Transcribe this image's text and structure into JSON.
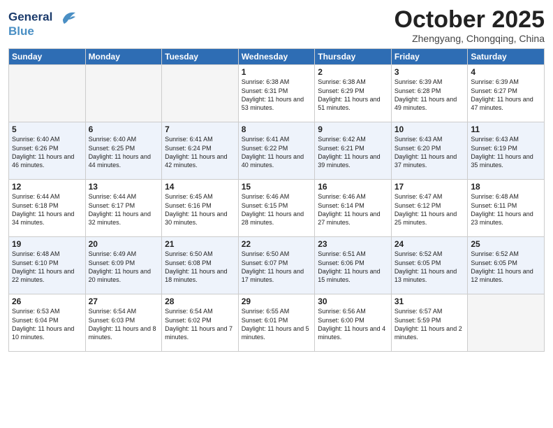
{
  "header": {
    "logo_line1": "General",
    "logo_line2": "Blue",
    "month": "October 2025",
    "location": "Zhengyang, Chongqing, China"
  },
  "weekdays": [
    "Sunday",
    "Monday",
    "Tuesday",
    "Wednesday",
    "Thursday",
    "Friday",
    "Saturday"
  ],
  "weeks": [
    [
      {
        "day": "",
        "info": ""
      },
      {
        "day": "",
        "info": ""
      },
      {
        "day": "",
        "info": ""
      },
      {
        "day": "1",
        "info": "Sunrise: 6:38 AM\nSunset: 6:31 PM\nDaylight: 11 hours and 53 minutes."
      },
      {
        "day": "2",
        "info": "Sunrise: 6:38 AM\nSunset: 6:29 PM\nDaylight: 11 hours and 51 minutes."
      },
      {
        "day": "3",
        "info": "Sunrise: 6:39 AM\nSunset: 6:28 PM\nDaylight: 11 hours and 49 minutes."
      },
      {
        "day": "4",
        "info": "Sunrise: 6:39 AM\nSunset: 6:27 PM\nDaylight: 11 hours and 47 minutes."
      }
    ],
    [
      {
        "day": "5",
        "info": "Sunrise: 6:40 AM\nSunset: 6:26 PM\nDaylight: 11 hours and 46 minutes."
      },
      {
        "day": "6",
        "info": "Sunrise: 6:40 AM\nSunset: 6:25 PM\nDaylight: 11 hours and 44 minutes."
      },
      {
        "day": "7",
        "info": "Sunrise: 6:41 AM\nSunset: 6:24 PM\nDaylight: 11 hours and 42 minutes."
      },
      {
        "day": "8",
        "info": "Sunrise: 6:41 AM\nSunset: 6:22 PM\nDaylight: 11 hours and 40 minutes."
      },
      {
        "day": "9",
        "info": "Sunrise: 6:42 AM\nSunset: 6:21 PM\nDaylight: 11 hours and 39 minutes."
      },
      {
        "day": "10",
        "info": "Sunrise: 6:43 AM\nSunset: 6:20 PM\nDaylight: 11 hours and 37 minutes."
      },
      {
        "day": "11",
        "info": "Sunrise: 6:43 AM\nSunset: 6:19 PM\nDaylight: 11 hours and 35 minutes."
      }
    ],
    [
      {
        "day": "12",
        "info": "Sunrise: 6:44 AM\nSunset: 6:18 PM\nDaylight: 11 hours and 34 minutes."
      },
      {
        "day": "13",
        "info": "Sunrise: 6:44 AM\nSunset: 6:17 PM\nDaylight: 11 hours and 32 minutes."
      },
      {
        "day": "14",
        "info": "Sunrise: 6:45 AM\nSunset: 6:16 PM\nDaylight: 11 hours and 30 minutes."
      },
      {
        "day": "15",
        "info": "Sunrise: 6:46 AM\nSunset: 6:15 PM\nDaylight: 11 hours and 28 minutes."
      },
      {
        "day": "16",
        "info": "Sunrise: 6:46 AM\nSunset: 6:14 PM\nDaylight: 11 hours and 27 minutes."
      },
      {
        "day": "17",
        "info": "Sunrise: 6:47 AM\nSunset: 6:12 PM\nDaylight: 11 hours and 25 minutes."
      },
      {
        "day": "18",
        "info": "Sunrise: 6:48 AM\nSunset: 6:11 PM\nDaylight: 11 hours and 23 minutes."
      }
    ],
    [
      {
        "day": "19",
        "info": "Sunrise: 6:48 AM\nSunset: 6:10 PM\nDaylight: 11 hours and 22 minutes."
      },
      {
        "day": "20",
        "info": "Sunrise: 6:49 AM\nSunset: 6:09 PM\nDaylight: 11 hours and 20 minutes."
      },
      {
        "day": "21",
        "info": "Sunrise: 6:50 AM\nSunset: 6:08 PM\nDaylight: 11 hours and 18 minutes."
      },
      {
        "day": "22",
        "info": "Sunrise: 6:50 AM\nSunset: 6:07 PM\nDaylight: 11 hours and 17 minutes."
      },
      {
        "day": "23",
        "info": "Sunrise: 6:51 AM\nSunset: 6:06 PM\nDaylight: 11 hours and 15 minutes."
      },
      {
        "day": "24",
        "info": "Sunrise: 6:52 AM\nSunset: 6:05 PM\nDaylight: 11 hours and 13 minutes."
      },
      {
        "day": "25",
        "info": "Sunrise: 6:52 AM\nSunset: 6:05 PM\nDaylight: 11 hours and 12 minutes."
      }
    ],
    [
      {
        "day": "26",
        "info": "Sunrise: 6:53 AM\nSunset: 6:04 PM\nDaylight: 11 hours and 10 minutes."
      },
      {
        "day": "27",
        "info": "Sunrise: 6:54 AM\nSunset: 6:03 PM\nDaylight: 11 hours and 8 minutes."
      },
      {
        "day": "28",
        "info": "Sunrise: 6:54 AM\nSunset: 6:02 PM\nDaylight: 11 hours and 7 minutes."
      },
      {
        "day": "29",
        "info": "Sunrise: 6:55 AM\nSunset: 6:01 PM\nDaylight: 11 hours and 5 minutes."
      },
      {
        "day": "30",
        "info": "Sunrise: 6:56 AM\nSunset: 6:00 PM\nDaylight: 11 hours and 4 minutes."
      },
      {
        "day": "31",
        "info": "Sunrise: 6:57 AM\nSunset: 5:59 PM\nDaylight: 11 hours and 2 minutes."
      },
      {
        "day": "",
        "info": ""
      }
    ]
  ]
}
